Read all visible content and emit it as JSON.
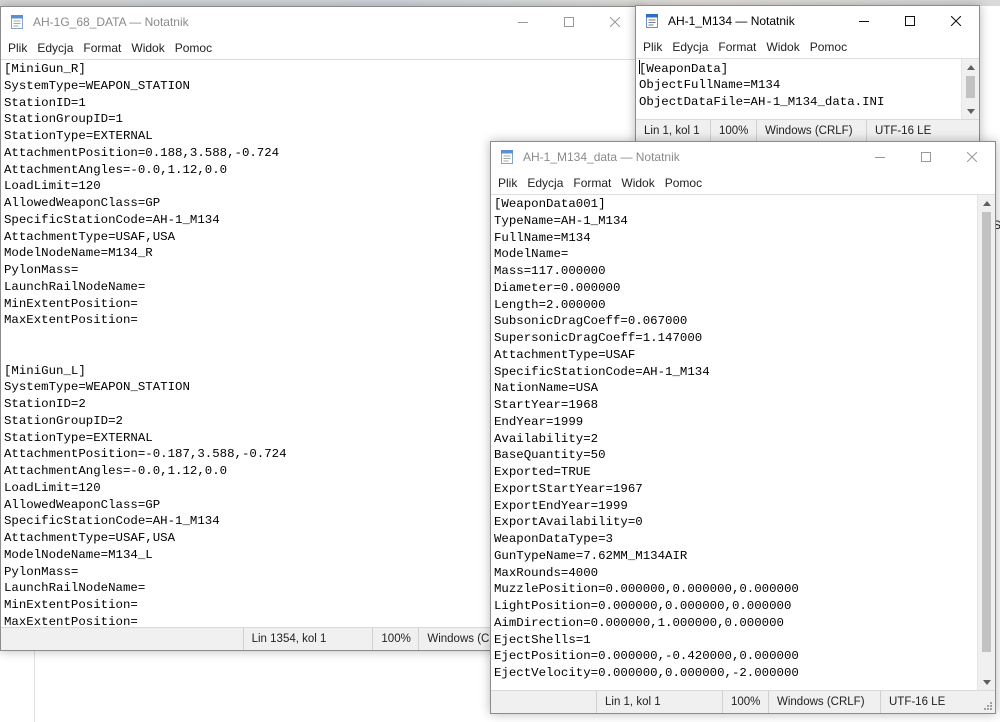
{
  "windows": {
    "main": {
      "title": "AH-1G_68_DATA — Notatnik",
      "menu": [
        "Plik",
        "Edycja",
        "Format",
        "Widok",
        "Pomoc"
      ],
      "lines": [
        "[MiniGun_R]",
        "SystemType=WEAPON_STATION",
        "StationID=1",
        "StationGroupID=1",
        "StationType=EXTERNAL",
        "AttachmentPosition=0.188,3.588,-0.724",
        "AttachmentAngles=-0.0,1.12,0.0",
        "LoadLimit=120",
        "AllowedWeaponClass=GP",
        "SpecificStationCode=AH-1_M134",
        "AttachmentType=USAF,USA",
        "ModelNodeName=M134_R",
        "PylonMass=",
        "LaunchRailNodeName=",
        "MinExtentPosition=",
        "MaxExtentPosition=",
        "",
        "",
        "[MiniGun_L]",
        "SystemType=WEAPON_STATION",
        "StationID=2",
        "StationGroupID=2",
        "StationType=EXTERNAL",
        "AttachmentPosition=-0.187,3.588,-0.724",
        "AttachmentAngles=-0.0,1.12,0.0",
        "LoadLimit=120",
        "AllowedWeaponClass=GP",
        "SpecificStationCode=AH-1_M134",
        "AttachmentType=USAF,USA",
        "ModelNodeName=M134_L",
        "PylonMass=",
        "LaunchRailNodeName=",
        "MinExtentPosition=",
        "MaxExtentPosition="
      ],
      "status": {
        "position": "Lin 1354, kol 1",
        "zoom": "100%",
        "line_ending": "Windows (CR"
      }
    },
    "object": {
      "title": "AH-1_M134 — Notatnik",
      "menu": [
        "Plik",
        "Edycja",
        "Format",
        "Widok",
        "Pomoc"
      ],
      "lines": [
        "[WeaponData]",
        "ObjectFullName=M134",
        "ObjectDataFile=AH-1_M134_data.INI"
      ],
      "status": {
        "position": "Lin 1, kol 1",
        "zoom": "100%",
        "line_ending": "Windows (CRLF)",
        "encoding": "UTF-16 LE"
      }
    },
    "data": {
      "title": "AH-1_M134_data — Notatnik",
      "menu": [
        "Plik",
        "Edycja",
        "Format",
        "Widok",
        "Pomoc"
      ],
      "lines": [
        "[WeaponData001]",
        "TypeName=AH-1_M134",
        "FullName=M134",
        "ModelName=",
        "Mass=117.000000",
        "Diameter=0.000000",
        "Length=2.000000",
        "SubsonicDragCoeff=0.067000",
        "SupersonicDragCoeff=1.147000",
        "AttachmentType=USAF",
        "SpecificStationCode=AH-1_M134",
        "NationName=USA",
        "StartYear=1968",
        "EndYear=1999",
        "Availability=2",
        "BaseQuantity=50",
        "Exported=TRUE",
        "ExportStartYear=1967",
        "ExportEndYear=1999",
        "ExportAvailability=0",
        "WeaponDataType=3",
        "GunTypeName=7.62MM_M134AIR",
        "MaxRounds=4000",
        "MuzzlePosition=0.000000,0.000000,0.000000",
        "LightPosition=0.000000,0.000000,0.000000",
        "AimDirection=0.000000,1.000000,0.000000",
        "EjectShells=1",
        "EjectPosition=0.000000,-0.420000,0.000000",
        "EjectVelocity=0.000000,0.000000,-2.000000"
      ],
      "status": {
        "position": "Lin 1, kol 1",
        "zoom": "100%",
        "line_ending": "Windows (CRLF)",
        "encoding": "UTF-16 LE"
      }
    }
  },
  "background_edge_text": "SI",
  "colors": {
    "inactive_title": "#8a8a8a",
    "active_title": "#000000",
    "statusbar_bg": "#f0f0f0",
    "scroll_thumb": "#c2c2c2"
  }
}
